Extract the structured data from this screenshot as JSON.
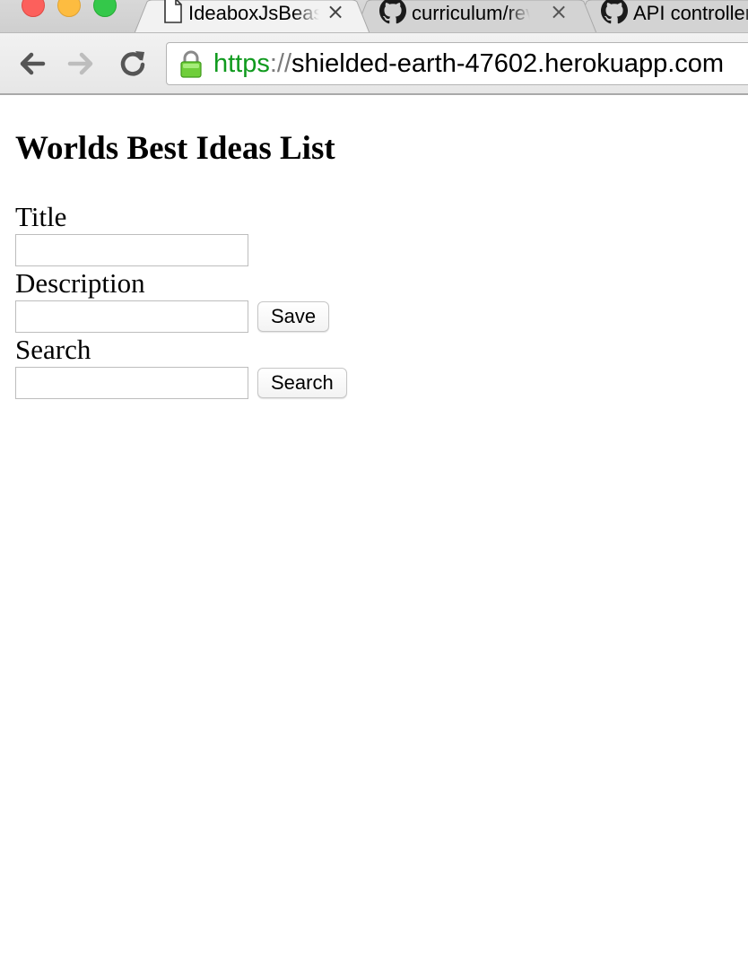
{
  "browser": {
    "tabs": [
      {
        "title": "IdeaboxJsBeast",
        "icon": "page-icon",
        "close": "×"
      },
      {
        "title": "curriculum/review",
        "icon": "github-icon",
        "close": "×"
      },
      {
        "title": "API controllers",
        "icon": "github-icon"
      }
    ],
    "address": {
      "scheme": "https",
      "separator": "://",
      "host": "shielded-earth-47602.herokuapp.com"
    },
    "colors": {
      "secure_scheme": "#109a1e",
      "tab_active": "#f2f2f2",
      "tab_inactive": "#d3d3d3"
    }
  },
  "page": {
    "heading": "Worlds Best Ideas List",
    "form": {
      "title_label": "Title",
      "title_value": "",
      "description_label": "Description",
      "description_value": "",
      "save_label": "Save",
      "search_label": "Search",
      "search_value": "",
      "search_button_label": "Search"
    }
  }
}
